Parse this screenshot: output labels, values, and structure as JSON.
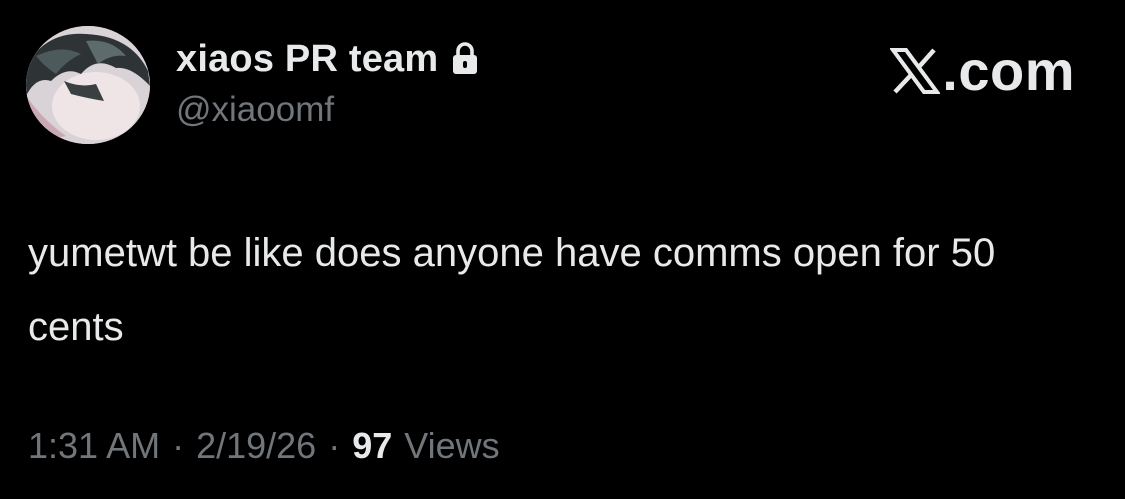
{
  "author": {
    "display_name": "xiaos PR team",
    "handle": "@xiaoomf",
    "protected_icon": "lock-icon",
    "avatar": "profile-picture"
  },
  "brand": {
    "icon": "x-logo-icon",
    "text": ".com"
  },
  "tweet": {
    "text": "yumetwt be like does anyone have comms open for 50 cents"
  },
  "meta": {
    "time": "1:31 AM",
    "separator": "·",
    "date": "2/19/26",
    "views_count": "97",
    "views_label": "Views"
  },
  "colors": {
    "background": "#000000",
    "primary_text": "#e7e9ea",
    "secondary_text": "#71767b"
  }
}
